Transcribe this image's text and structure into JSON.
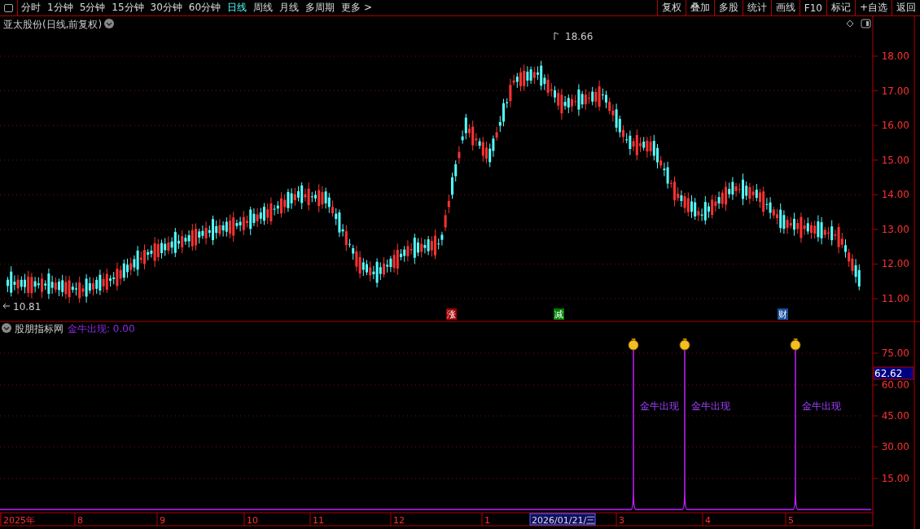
{
  "toolbar": {
    "periods": [
      {
        "label": "分时",
        "selected": false
      },
      {
        "label": "1分钟",
        "selected": false
      },
      {
        "label": "5分钟",
        "selected": false
      },
      {
        "label": "15分钟",
        "selected": false
      },
      {
        "label": "30分钟",
        "selected": false
      },
      {
        "label": "60分钟",
        "selected": false
      },
      {
        "label": "日线",
        "selected": true
      },
      {
        "label": "周线",
        "selected": false
      },
      {
        "label": "月线",
        "selected": false
      },
      {
        "label": "多周期",
        "selected": false
      },
      {
        "label": "更多 >",
        "selected": false
      }
    ],
    "actions": [
      "复权",
      "叠加",
      "多股",
      "统计",
      "画线",
      "F10",
      "标记",
      "+自选",
      "返回"
    ]
  },
  "price_panel": {
    "title": "亚太股份(日线,前复权)",
    "high_marker": "18.66",
    "low_marker": "10.81",
    "y_ticks": [
      "18.00",
      "17.00",
      "16.00",
      "15.00",
      "14.00",
      "13.00",
      "12.00",
      "11.00"
    ],
    "event_badges": [
      {
        "label": "涨",
        "color": "#a00000"
      },
      {
        "label": "减",
        "color": "#008000"
      },
      {
        "label": "财",
        "color": "#1a4f9a"
      }
    ]
  },
  "indicator_panel": {
    "title": "股朋指标网",
    "reading": "金牛出现: 0.00",
    "signal_labels": [
      "金牛出现",
      "金牛出现",
      "金牛出现"
    ],
    "y_ticks": [
      "75.00",
      "60.00",
      "45.00",
      "30.00",
      "15.00"
    ],
    "cursor_value": "62.62"
  },
  "date_axis": [
    {
      "label": "2025年",
      "selected": false
    },
    {
      "label": "8",
      "selected": false
    },
    {
      "label": "9",
      "selected": false
    },
    {
      "label": "10",
      "selected": false
    },
    {
      "label": "11",
      "selected": false
    },
    {
      "label": "12",
      "selected": false
    },
    {
      "label": "1",
      "selected": false
    },
    {
      "label": "2026/01/21/三",
      "selected": true
    },
    {
      "label": "3",
      "selected": false
    },
    {
      "label": "4",
      "selected": false
    },
    {
      "label": "5",
      "selected": false
    }
  ]
}
